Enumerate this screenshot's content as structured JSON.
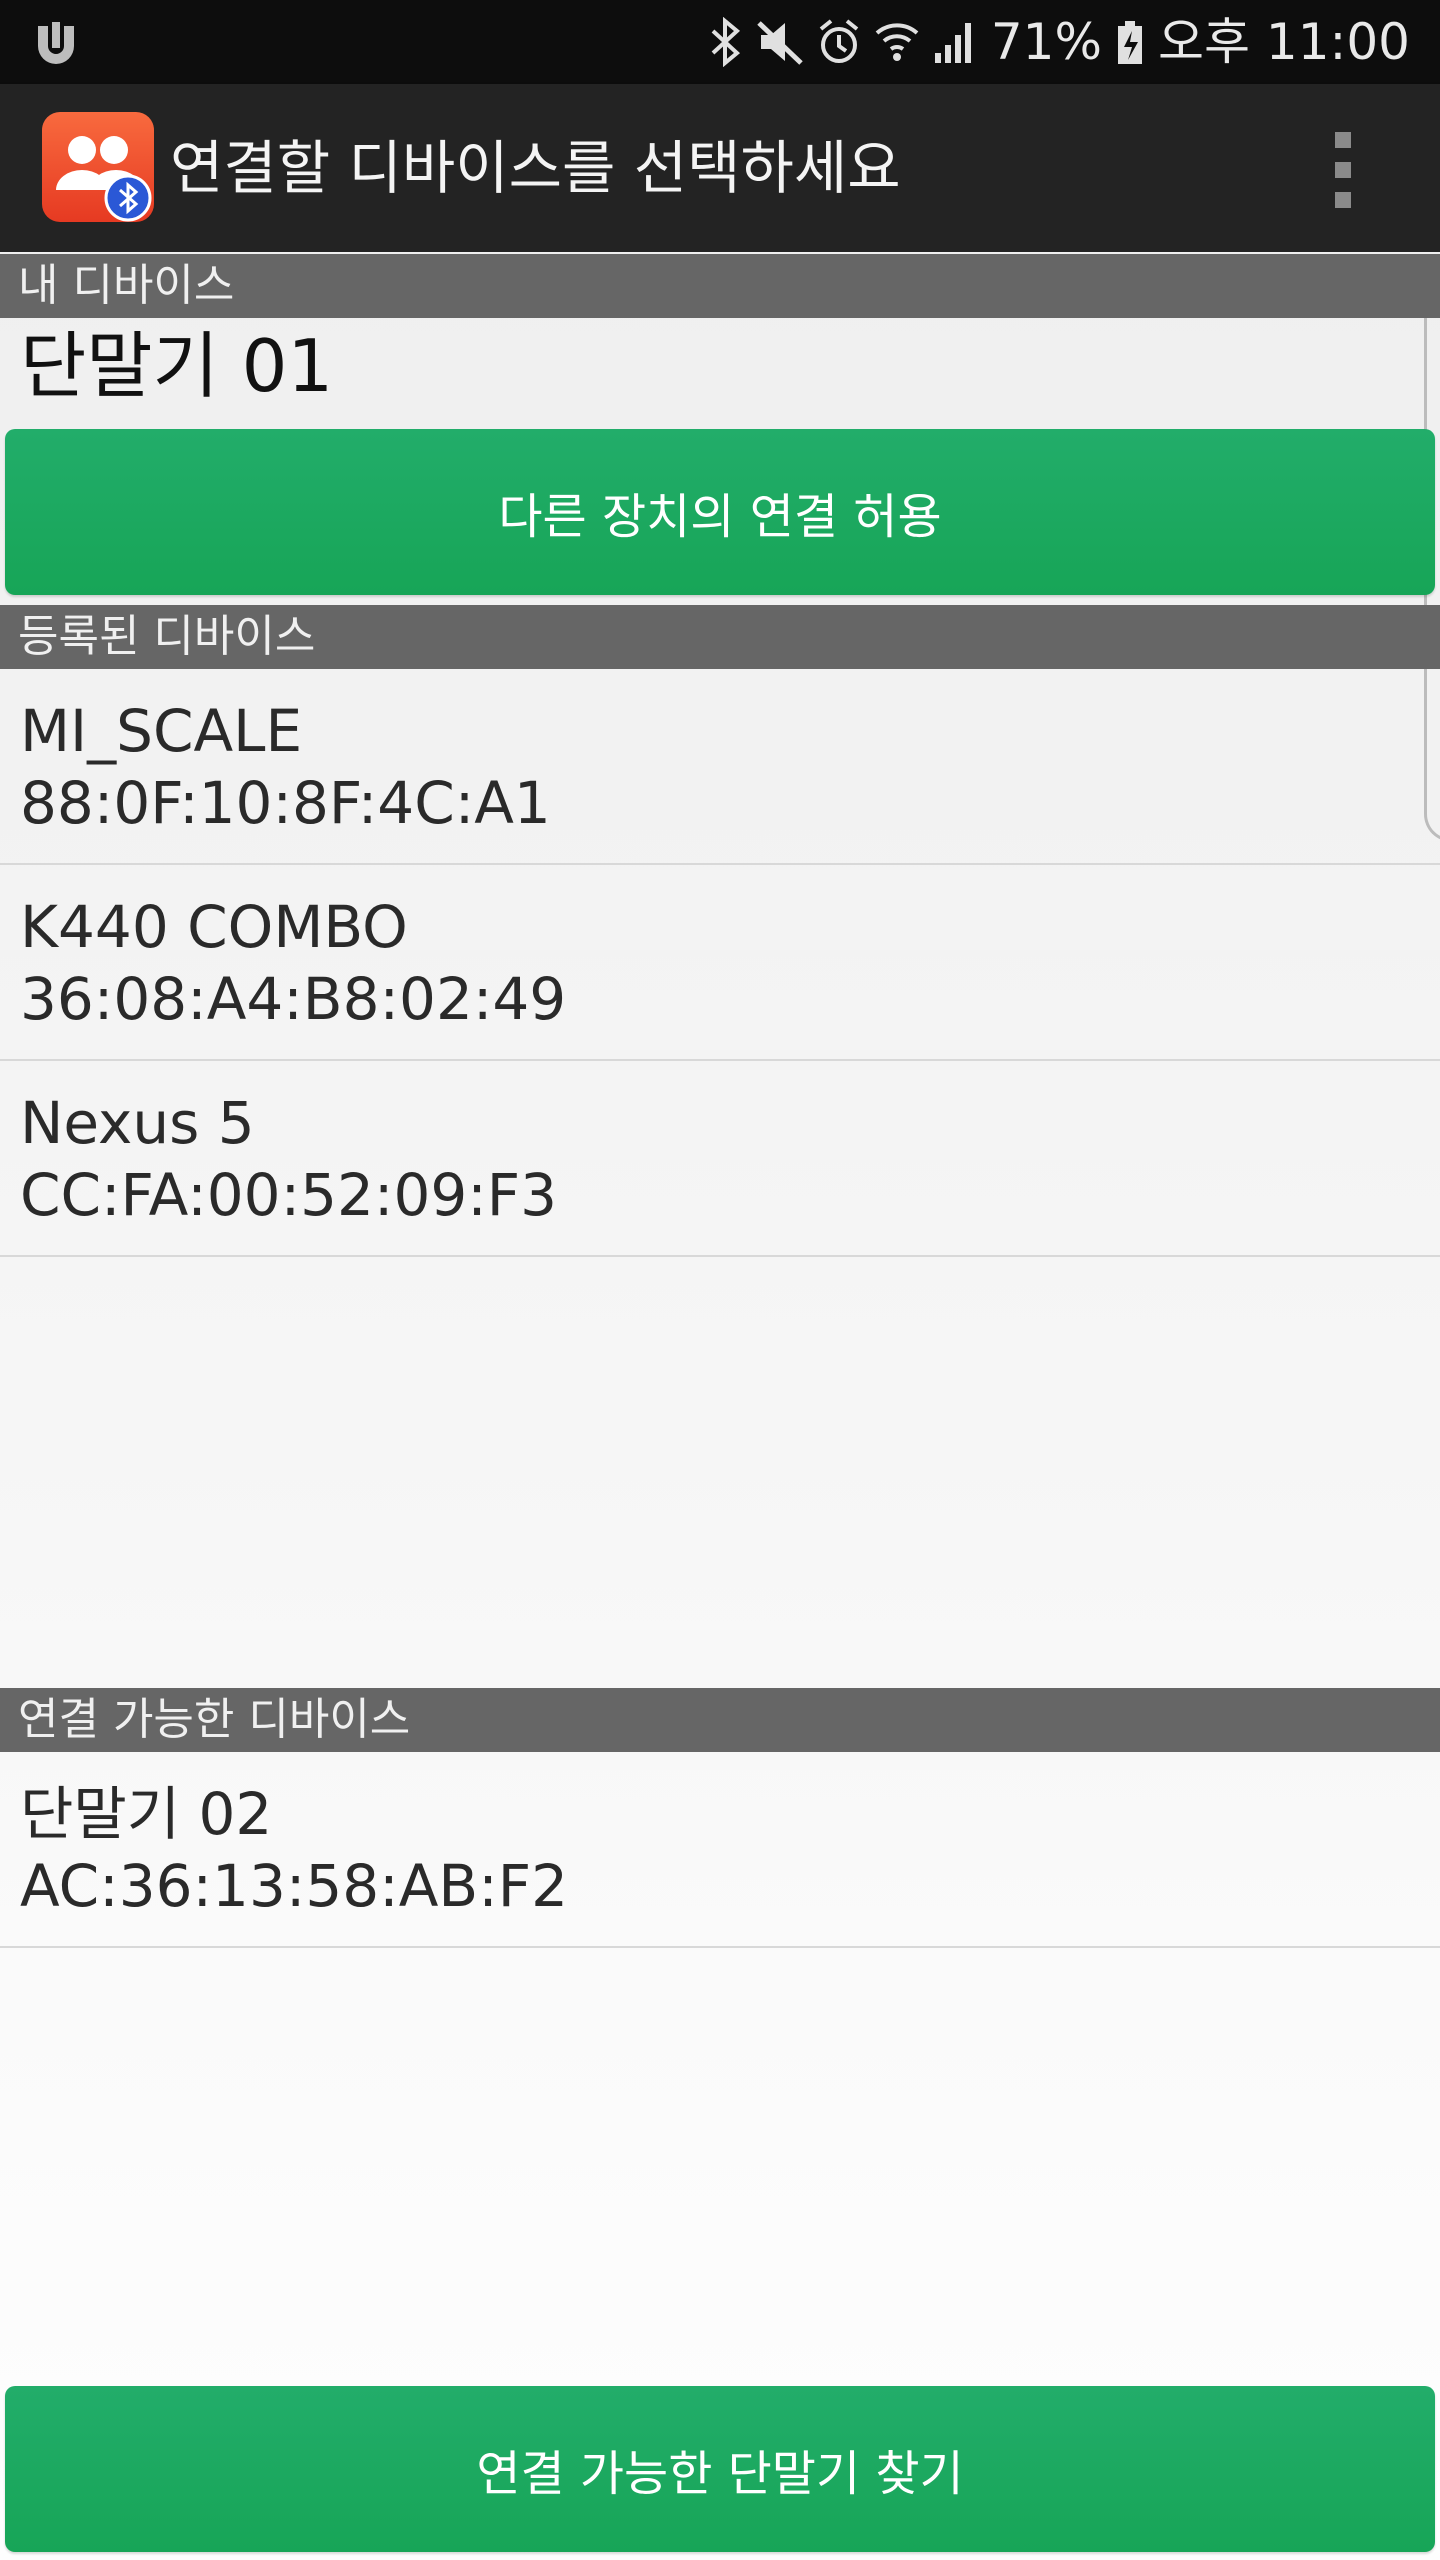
{
  "status_bar": {
    "battery_percent": "71%",
    "time": "오후 11:00",
    "icons": [
      "app-notification-icon",
      "bluetooth-icon",
      "mute-icon",
      "alarm-icon",
      "wifi-icon",
      "signal-icon",
      "battery-charging-icon"
    ]
  },
  "app_bar": {
    "title": "연결할 디바이스를 선택하세요",
    "icon": "bluetooth-people-app-icon",
    "menu_icon": "overflow-menu-icon"
  },
  "my_device": {
    "header": "내 디바이스",
    "name": "단말기 01",
    "allow_button_label": "다른 장치의 연결 허용"
  },
  "registered_devices": {
    "header": "등록된 디바이스",
    "items": [
      {
        "name": "MI_SCALE",
        "address": "88:0F:10:8F:4C:A1"
      },
      {
        "name": "K440 COMBO",
        "address": "36:08:A4:B8:02:49"
      },
      {
        "name": "Nexus 5",
        "address": "CC:FA:00:52:09:F3"
      }
    ]
  },
  "available_devices": {
    "header": "연결 가능한 디바이스",
    "items": [
      {
        "name": "단말기 02",
        "address": "AC:36:13:58:AB:F2"
      }
    ]
  },
  "scan_button_label": "연결 가능한 단말기 찾기",
  "colors": {
    "accent_green": "#1aa75d",
    "section_header": "#666666",
    "app_bar": "#232323",
    "app_icon": "#ef4a2c"
  }
}
